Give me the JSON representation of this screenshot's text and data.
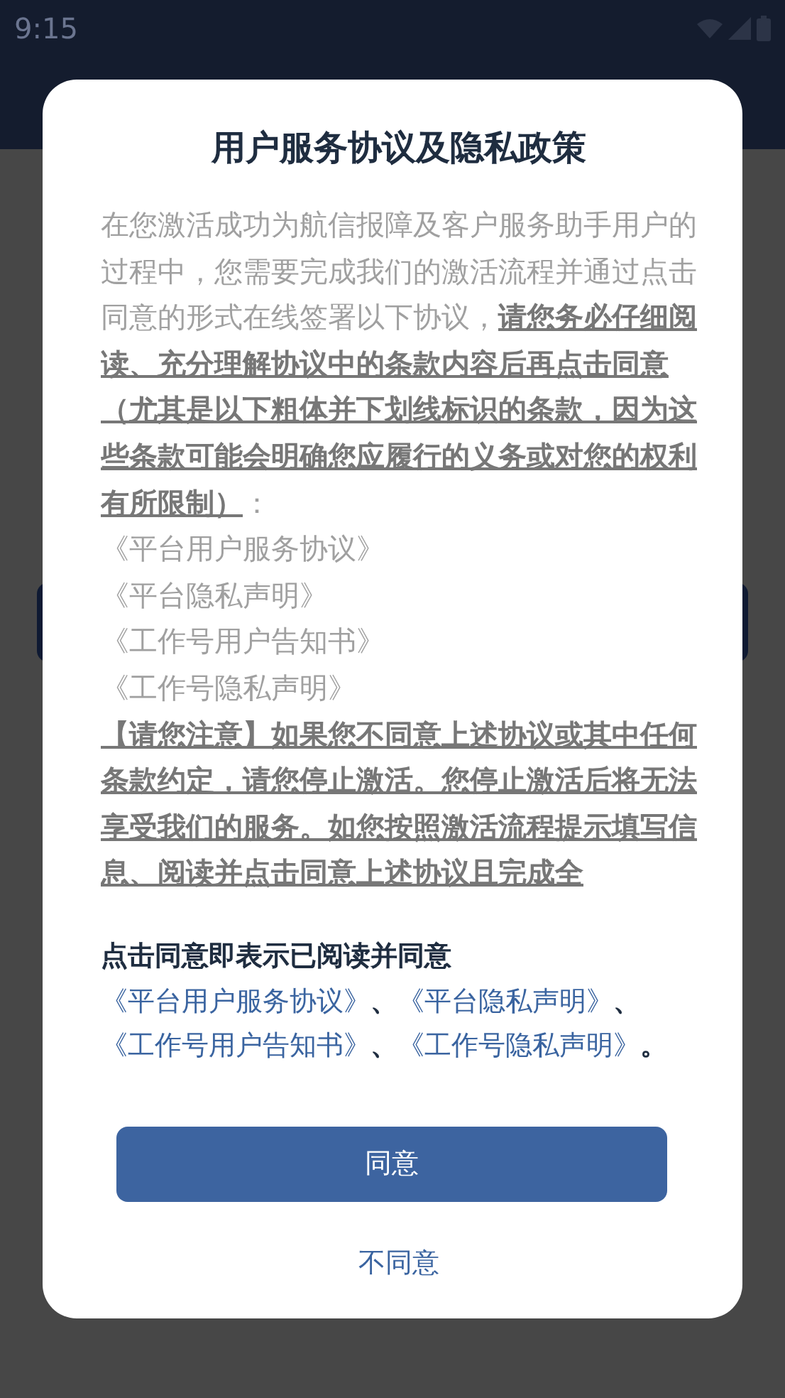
{
  "status_bar": {
    "time": "9:15"
  },
  "dialog": {
    "title": "用户服务协议及隐私政策",
    "intro": "在您激活成功为航信报障及客户服务助手用户的过程中，您需要完成我们的激活流程并通过点击同意的形式在线签署以下协议，**请您务必仔细阅读、充分理解协议中的条款内容后再点击同意（尤其是以下粗体并下划线标识的条款，因为这些条款可能会明确您应履行的义务或对您的权利有所限制）**：",
    "documents": [
      "《平台用户服务协议》",
      "《平台隐私声明》",
      "《工作号用户告知书》",
      "《工作号隐私声明》"
    ],
    "notice": "【请您注意】如果您不同意上述协议或其中任何条款约定，请您停止激活。您停止激活后将无法享受我们的服务。如您按照激活流程提示填写信息、阅读并点击同意上述协议且完成全",
    "consent": [
      {
        "kind": "text",
        "text": "点击同意即表示已阅读并同意"
      },
      {
        "kind": "link",
        "text": "《平台用户服务协议》"
      },
      {
        "kind": "text",
        "text": "、"
      },
      {
        "kind": "link",
        "text": "《平台隐私声明》"
      },
      {
        "kind": "text",
        "text": "、"
      },
      {
        "kind": "link",
        "text": "《工作号用户告知书》"
      },
      {
        "kind": "text",
        "text": "、"
      },
      {
        "kind": "link",
        "text": "《工作号隐私声明》"
      },
      {
        "kind": "text",
        "text": "。"
      }
    ],
    "agree_button": "同意",
    "disagree_button": "不同意"
  }
}
